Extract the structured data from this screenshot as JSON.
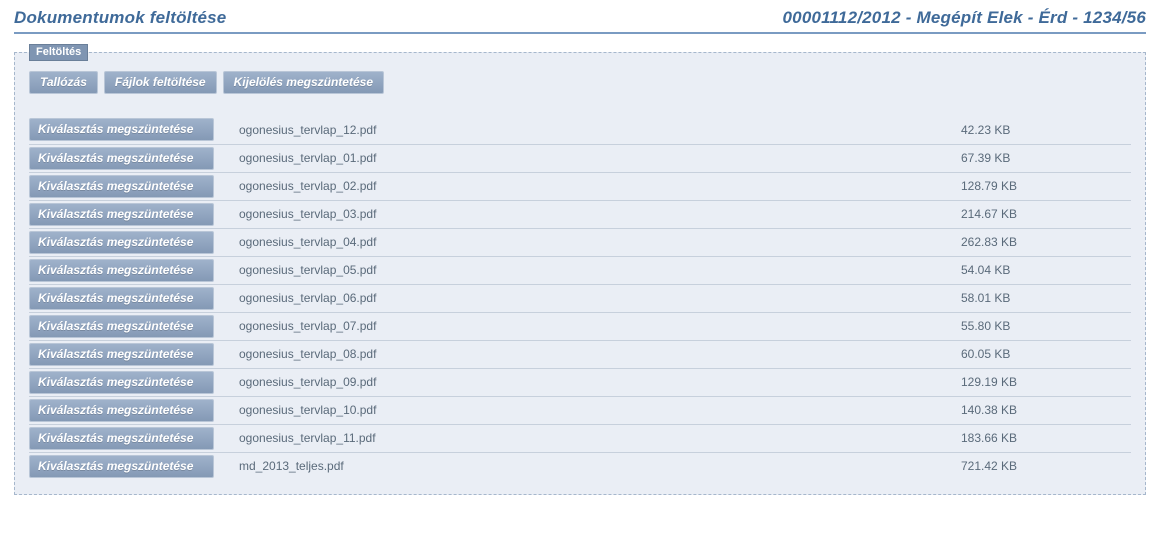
{
  "header": {
    "title_left": "Dokumentumok feltöltése",
    "title_right": "00001112/2012 - Megépít Elek - Érd - 1234/56"
  },
  "upload": {
    "box_label": "Feltöltés",
    "toolbar": {
      "browse": "Tallózás",
      "upload_files": "Fájlok feltöltése",
      "deselect_all": "Kijelölés megszüntetése"
    },
    "row_button_label": "Kiválasztás megszüntetése",
    "files": [
      {
        "name": "ogonesius_tervlap_12.pdf",
        "size": "42.23 KB"
      },
      {
        "name": "ogonesius_tervlap_01.pdf",
        "size": "67.39 KB"
      },
      {
        "name": "ogonesius_tervlap_02.pdf",
        "size": "128.79 KB"
      },
      {
        "name": "ogonesius_tervlap_03.pdf",
        "size": "214.67 KB"
      },
      {
        "name": "ogonesius_tervlap_04.pdf",
        "size": "262.83 KB"
      },
      {
        "name": "ogonesius_tervlap_05.pdf",
        "size": "54.04 KB"
      },
      {
        "name": "ogonesius_tervlap_06.pdf",
        "size": "58.01 KB"
      },
      {
        "name": "ogonesius_tervlap_07.pdf",
        "size": "55.80 KB"
      },
      {
        "name": "ogonesius_tervlap_08.pdf",
        "size": "60.05 KB"
      },
      {
        "name": "ogonesius_tervlap_09.pdf",
        "size": "129.19 KB"
      },
      {
        "name": "ogonesius_tervlap_10.pdf",
        "size": "140.38 KB"
      },
      {
        "name": "ogonesius_tervlap_11.pdf",
        "size": "183.66 KB"
      },
      {
        "name": "md_2013_teljes.pdf",
        "size": "721.42 KB"
      }
    ]
  }
}
